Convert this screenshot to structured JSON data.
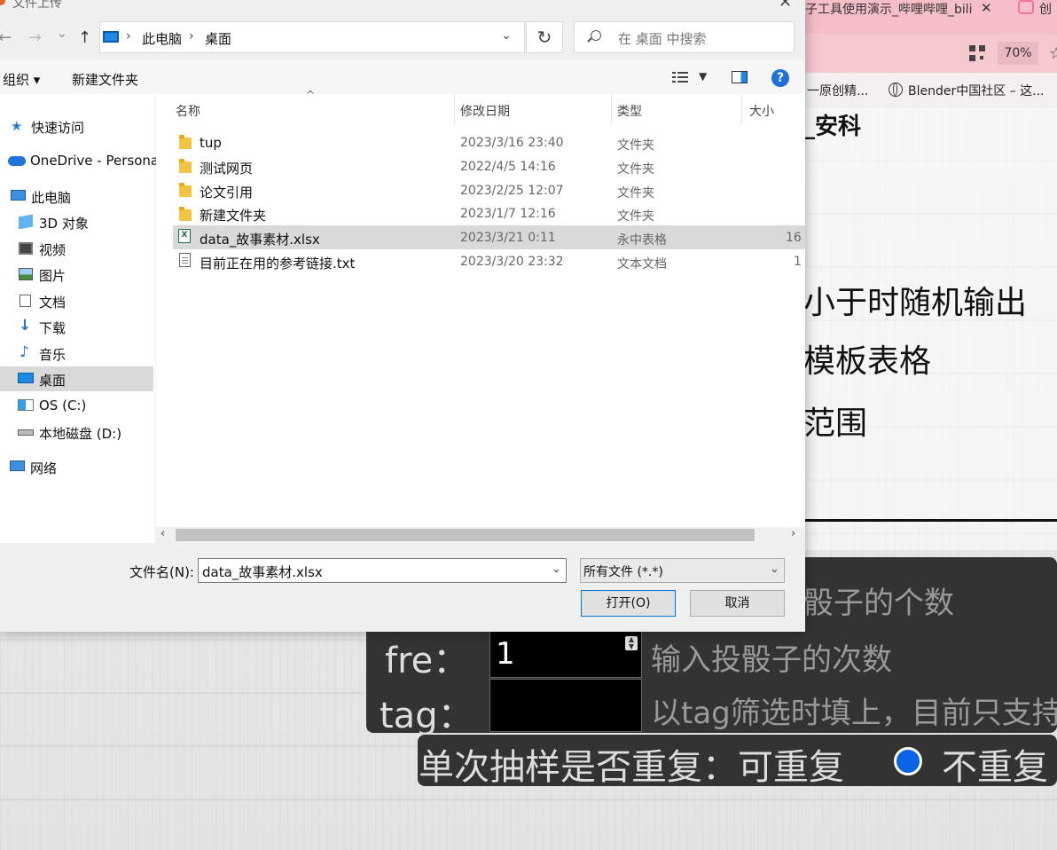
{
  "browser": {
    "tab_title": "子工具使用演示_哔哩哔哩_bili",
    "tab_close": "✕",
    "tab2_title": "创",
    "zoom": "70%",
    "bookmark1": "一原创精...",
    "bookmark2": "Blender中国社区 – 这...",
    "star": "☆"
  },
  "page": {
    "title": "_安科",
    "lines": [
      "小于时随机输出",
      "模板表格",
      "范围"
    ]
  },
  "panel": {
    "row1_hint": "骰子的个数",
    "fre_label": "fre：",
    "fre_value": "1",
    "fre_hint": "输入投骰子的次数",
    "tag_label": "tag：",
    "tag_value": "",
    "tag_hint": "以tag筛选时填上，目前只支持",
    "repeat_label": "单次抽样是否重复：可重复",
    "repeat_option2": "不重复"
  },
  "dialog": {
    "title": "文件上传",
    "close": "✕",
    "nav": {
      "back": "←",
      "forward": "→",
      "recent": "⌄",
      "up": "↑"
    },
    "address": {
      "root": "此电脑",
      "current": "桌面",
      "sep": "›"
    },
    "search_placeholder": "在 桌面 中搜索",
    "toolbar": {
      "organize": "组织 ▾",
      "new_folder": "新建文件夹",
      "help": "?"
    },
    "sidebar": [
      {
        "label": "快速访问",
        "icon": "star-icon"
      },
      {
        "label": "OneDrive - Persona",
        "icon": "cloud-icon"
      },
      {
        "label": "此电脑",
        "icon": "computer-icon"
      },
      {
        "label": "3D 对象",
        "icon": "cube-icon"
      },
      {
        "label": "视频",
        "icon": "video-icon"
      },
      {
        "label": "图片",
        "icon": "picture-icon"
      },
      {
        "label": "文档",
        "icon": "document-icon"
      },
      {
        "label": "下载",
        "icon": "download-icon"
      },
      {
        "label": "音乐",
        "icon": "music-icon"
      },
      {
        "label": "桌面",
        "icon": "desktop-icon",
        "selected": true
      },
      {
        "label": "OS (C:)",
        "icon": "drive-c-icon"
      },
      {
        "label": "本地磁盘 (D:)",
        "icon": "drive-d-icon"
      },
      {
        "label": "网络",
        "icon": "network-icon"
      }
    ],
    "columns": {
      "name": "名称",
      "date": "修改日期",
      "type": "类型",
      "size": "大小"
    },
    "files": [
      {
        "name": "tup",
        "date": "2023/3/16 23:40",
        "type": "文件夹",
        "size": "",
        "icon": "folder-icon"
      },
      {
        "name": "测试网页",
        "date": "2022/4/5 14:16",
        "type": "文件夹",
        "size": "",
        "icon": "folder-icon"
      },
      {
        "name": "论文引用",
        "date": "2023/2/25 12:07",
        "type": "文件夹",
        "size": "",
        "icon": "folder-icon"
      },
      {
        "name": "新建文件夹",
        "date": "2023/1/7 12:16",
        "type": "文件夹",
        "size": "",
        "icon": "folder-icon"
      },
      {
        "name": "data_故事素材.xlsx",
        "date": "2023/3/21 0:11",
        "type": "永中表格",
        "size": "16",
        "icon": "xlsx-file-icon",
        "selected": true
      },
      {
        "name": "目前正在用的参考链接.txt",
        "date": "2023/3/20 23:32",
        "type": "文本文档",
        "size": "1",
        "icon": "text-file-icon"
      }
    ],
    "filename_label": "文件名(N):",
    "filename_value": "data_故事素材.xlsx",
    "filter_value": "所有文件 (*.*)",
    "open_label": "打开(O)",
    "cancel_label": "取消"
  }
}
